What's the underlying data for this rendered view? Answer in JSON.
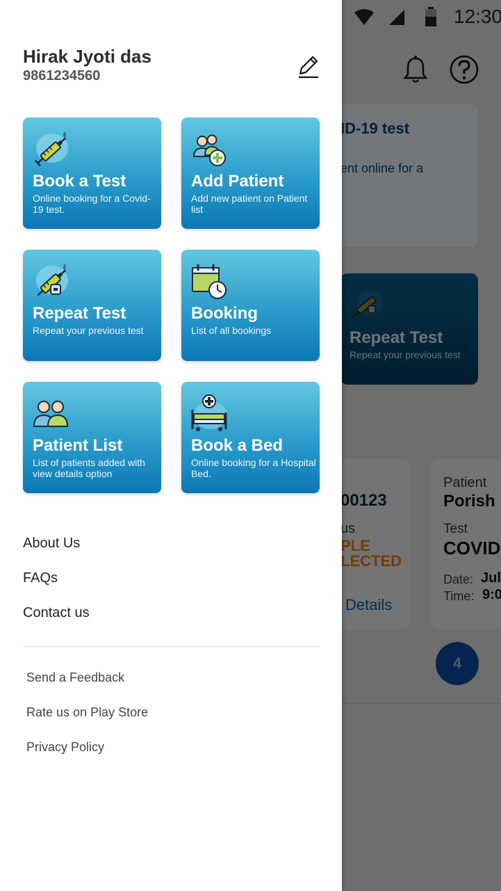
{
  "status_bar": {
    "time": "12:30"
  },
  "background": {
    "banner": {
      "title": "ID-19 test",
      "text": "ent online for a"
    },
    "card": {
      "title": "Repeat Test",
      "desc": "Repeat your previous test"
    },
    "booking_card_1": {
      "id": "00123",
      "status_label": "us",
      "status_line1": "PLE",
      "status_line2": "LECTED",
      "details_link": "Details"
    },
    "booking_card_2": {
      "patient_label": "Patient",
      "patient_value": "Porish",
      "test_label": "Test",
      "test_value": "COVID",
      "date_label": "Date:",
      "date_value": "Jul",
      "time_label": "Time:",
      "time_value": "9:0"
    },
    "badge": "4"
  },
  "user": {
    "name": "Hirak Jyoti das",
    "phone": "9861234560"
  },
  "tiles": [
    {
      "title": "Book a Test",
      "desc": "Online booking for a Covid-19 test.",
      "icon": "syringe-icon"
    },
    {
      "title": "Add Patient",
      "desc": "Add new patient on Patient list",
      "icon": "add-patient-icon"
    },
    {
      "title": "Repeat Test",
      "desc": "Repeat your previous test",
      "icon": "repeat-syringe-icon"
    },
    {
      "title": "Booking",
      "desc": "List of all bookings",
      "icon": "calendar-clock-icon"
    },
    {
      "title": "Patient List",
      "desc": "List of patients added with view details option",
      "icon": "patients-icon"
    },
    {
      "title": "Book a Bed",
      "desc": "Online booking for a  Hospital Bed.",
      "icon": "hospital-bed-icon"
    }
  ],
  "menu": {
    "main": [
      "About Us",
      "FAQs",
      "Contact us"
    ],
    "secondary": [
      "Send a Feedback",
      "Rate us on Play Store",
      "Privacy Policy"
    ]
  },
  "colors": {
    "tile_top": "#62c7e0",
    "tile_bottom": "#0b78b4",
    "accent_orange": "#e07a10",
    "dark_navy": "#0b3f70"
  }
}
